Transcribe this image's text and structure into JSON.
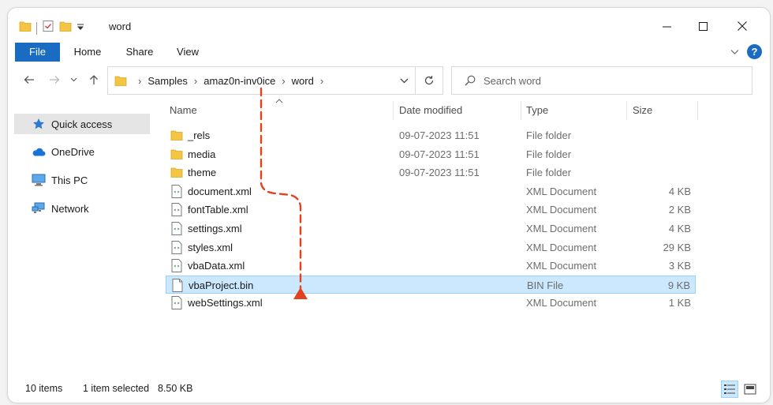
{
  "window": {
    "title": "word",
    "controls": {
      "minimize": "—",
      "maximize": "☐",
      "close": "✕"
    }
  },
  "ribbon": {
    "tabs": [
      "File",
      "Home",
      "Share",
      "View"
    ],
    "help_label": "?"
  },
  "navigation": {
    "breadcrumbs": [
      "Samples",
      "amaz0n-inv0ice",
      "word"
    ]
  },
  "search": {
    "placeholder": "Search word"
  },
  "sidebar": {
    "items": [
      {
        "label": "Quick access",
        "icon": "star-icon",
        "active": true
      },
      {
        "label": "OneDrive",
        "icon": "cloud-icon",
        "active": false
      },
      {
        "label": "This PC",
        "icon": "computer-icon",
        "active": false
      },
      {
        "label": "Network",
        "icon": "network-icon",
        "active": false
      }
    ]
  },
  "file_list": {
    "headers": {
      "name": "Name",
      "date": "Date modified",
      "type": "Type",
      "size": "Size"
    },
    "files": [
      {
        "name": "_rels",
        "date": "09-07-2023 11:51",
        "type": "File folder",
        "size": "",
        "icon": "folder-icon",
        "selected": false
      },
      {
        "name": "media",
        "date": "09-07-2023 11:51",
        "type": "File folder",
        "size": "",
        "icon": "folder-icon",
        "selected": false
      },
      {
        "name": "theme",
        "date": "09-07-2023 11:51",
        "type": "File folder",
        "size": "",
        "icon": "folder-icon",
        "selected": false
      },
      {
        "name": "document.xml",
        "date": "",
        "type": "XML Document",
        "size": "4 KB",
        "icon": "xml-file-icon",
        "selected": false
      },
      {
        "name": "fontTable.xml",
        "date": "",
        "type": "XML Document",
        "size": "2 KB",
        "icon": "xml-file-icon",
        "selected": false
      },
      {
        "name": "settings.xml",
        "date": "",
        "type": "XML Document",
        "size": "4 KB",
        "icon": "xml-file-icon",
        "selected": false
      },
      {
        "name": "styles.xml",
        "date": "",
        "type": "XML Document",
        "size": "29 KB",
        "icon": "xml-file-icon",
        "selected": false
      },
      {
        "name": "vbaData.xml",
        "date": "",
        "type": "XML Document",
        "size": "3 KB",
        "icon": "xml-file-icon",
        "selected": false
      },
      {
        "name": "vbaProject.bin",
        "date": "",
        "type": "BIN File",
        "size": "9 KB",
        "icon": "bin-file-icon",
        "selected": true
      },
      {
        "name": "webSettings.xml",
        "date": "",
        "type": "XML Document",
        "size": "1 KB",
        "icon": "xml-file-icon",
        "selected": false
      }
    ]
  },
  "status_bar": {
    "item_count": "10 items",
    "selection": "1 item selected",
    "selection_size": "8.50 KB"
  },
  "colors": {
    "accent": "#1a6cc3",
    "selection_bg": "#cce8ff",
    "annotation": "#e2421d",
    "folder": "#f4c542"
  }
}
